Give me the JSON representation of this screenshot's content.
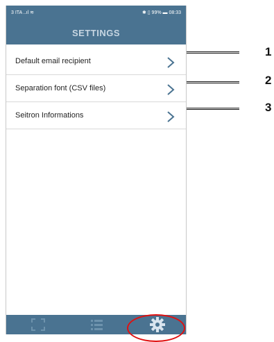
{
  "status_bar": {
    "left_text": "3 ITA",
    "right_text": "99%",
    "time": "08:33"
  },
  "header": {
    "title": "SETTINGS"
  },
  "settings_items": [
    {
      "label": "Default email recipient"
    },
    {
      "label": "Separation font (CSV files)"
    },
    {
      "label": "Seitron Informations"
    }
  ],
  "callouts": [
    "1",
    "2",
    "3"
  ],
  "colors": {
    "header_bg": "#4a7391",
    "chevron": "#4a7391",
    "highlight": "#e01010"
  },
  "tab_bar": {
    "tabs": [
      {
        "icon": "scan-frame-icon"
      },
      {
        "icon": "list-icon"
      },
      {
        "icon": "gear-icon"
      }
    ],
    "selected": "gear-icon"
  }
}
